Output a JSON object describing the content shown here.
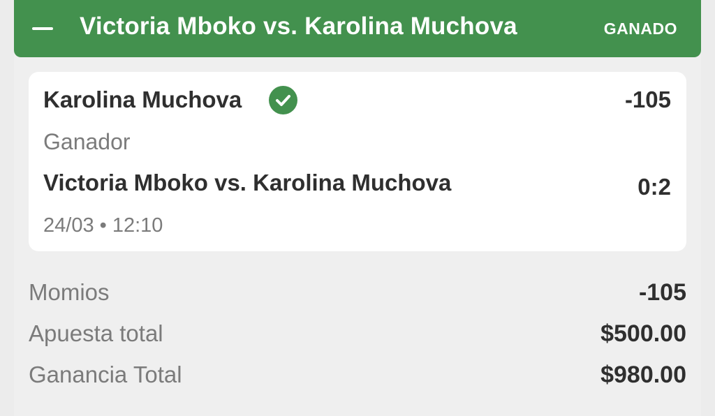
{
  "header": {
    "title": "Victoria Mboko vs. Karolina Muchova",
    "status": "GANADO",
    "accent_color": "#43914e",
    "collapse_icon": "minus-icon"
  },
  "selection": {
    "name": "Karolina Muchova",
    "status_icon": "check-circle-icon",
    "odds": "-105",
    "market": "Ganador",
    "event": "Victoria Mboko vs. Karolina Muchova",
    "score": "0:2",
    "datetime": "24/03 • 12:10"
  },
  "summary": [
    {
      "label": "Momios",
      "value": "-105"
    },
    {
      "label": "Apuesta total",
      "value": "$500.00"
    },
    {
      "label": "Ganancia Total",
      "value": "$980.00"
    }
  ]
}
